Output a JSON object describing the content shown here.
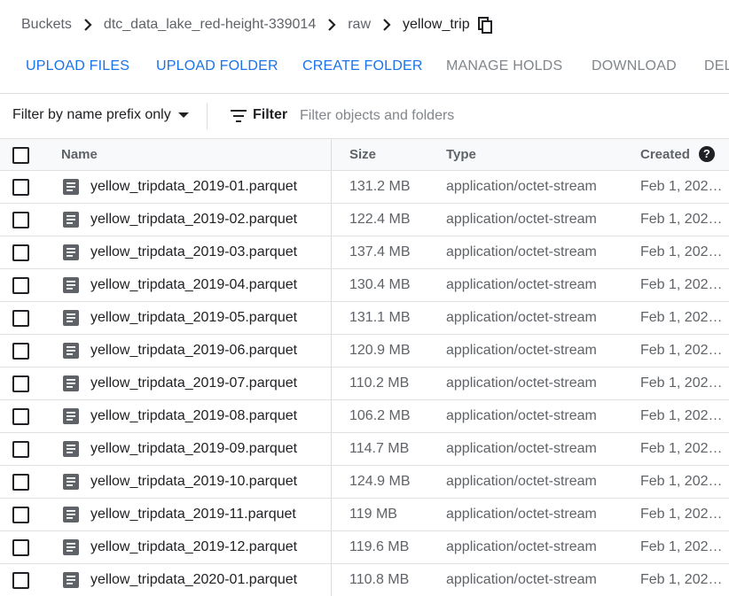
{
  "breadcrumb": {
    "items": [
      "Buckets",
      "dtc_data_lake_red-height-339014",
      "raw"
    ],
    "current": "yellow_trip"
  },
  "actions": {
    "upload_files": "UPLOAD FILES",
    "upload_folder": "UPLOAD FOLDER",
    "create_folder": "CREATE FOLDER",
    "manage_holds": "MANAGE HOLDS",
    "download": "DOWNLOAD",
    "delete": "DEL"
  },
  "filterbar": {
    "prefix_dropdown": "Filter by name prefix only",
    "filter_label": "Filter",
    "placeholder": "Filter objects and folders"
  },
  "table": {
    "headers": {
      "name": "Name",
      "size": "Size",
      "type": "Type",
      "created": "Created"
    },
    "help_glyph": "?",
    "rows": [
      {
        "name": "yellow_tripdata_2019-01.parquet",
        "size": "131.2 MB",
        "type": "application/octet-stream",
        "created": "Feb 1, 202…"
      },
      {
        "name": "yellow_tripdata_2019-02.parquet",
        "size": "122.4 MB",
        "type": "application/octet-stream",
        "created": "Feb 1, 202…"
      },
      {
        "name": "yellow_tripdata_2019-03.parquet",
        "size": "137.4 MB",
        "type": "application/octet-stream",
        "created": "Feb 1, 202…"
      },
      {
        "name": "yellow_tripdata_2019-04.parquet",
        "size": "130.4 MB",
        "type": "application/octet-stream",
        "created": "Feb 1, 202…"
      },
      {
        "name": "yellow_tripdata_2019-05.parquet",
        "size": "131.1 MB",
        "type": "application/octet-stream",
        "created": "Feb 1, 202…"
      },
      {
        "name": "yellow_tripdata_2019-06.parquet",
        "size": "120.9 MB",
        "type": "application/octet-stream",
        "created": "Feb 1, 202…"
      },
      {
        "name": "yellow_tripdata_2019-07.parquet",
        "size": "110.2 MB",
        "type": "application/octet-stream",
        "created": "Feb 1, 202…"
      },
      {
        "name": "yellow_tripdata_2019-08.parquet",
        "size": "106.2 MB",
        "type": "application/octet-stream",
        "created": "Feb 1, 202…"
      },
      {
        "name": "yellow_tripdata_2019-09.parquet",
        "size": "114.7 MB",
        "type": "application/octet-stream",
        "created": "Feb 1, 202…"
      },
      {
        "name": "yellow_tripdata_2019-10.parquet",
        "size": "124.9 MB",
        "type": "application/octet-stream",
        "created": "Feb 1, 202…"
      },
      {
        "name": "yellow_tripdata_2019-11.parquet",
        "size": "119 MB",
        "type": "application/octet-stream",
        "created": "Feb 1, 202…"
      },
      {
        "name": "yellow_tripdata_2019-12.parquet",
        "size": "119.6 MB",
        "type": "application/octet-stream",
        "created": "Feb 1, 202…"
      },
      {
        "name": "yellow_tripdata_2020-01.parquet",
        "size": "110.8 MB",
        "type": "application/octet-stream",
        "created": "Feb 1, 202…"
      }
    ]
  },
  "icons": {
    "breadcrumb_separator": "chevron-right-icon",
    "copy": "copy-icon",
    "filter": "filter-list-icon",
    "file": "file-document-icon",
    "help": "help-icon",
    "dropdown": "caret-down-icon"
  },
  "colors": {
    "primary_action": "#1a73e8",
    "disabled_action": "#80868b",
    "secondary_text": "#5f6368",
    "header_bg": "#f8f9fa"
  }
}
